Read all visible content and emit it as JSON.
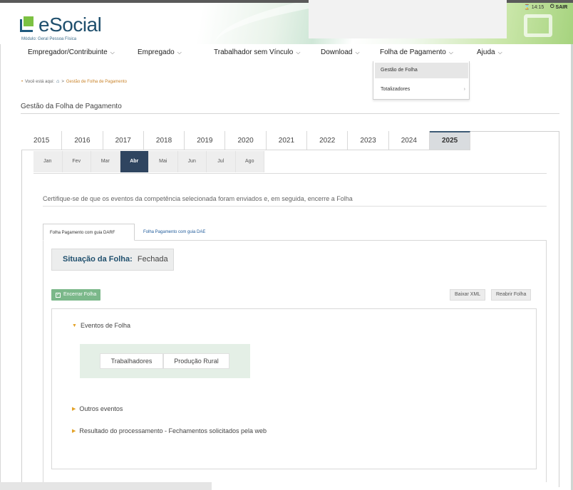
{
  "header": {
    "logo_text": "eSocial",
    "logo_sub": "Módulo: Geral Pessoa Física",
    "clock": "14:15",
    "sair": "SAIR"
  },
  "nav": {
    "items": [
      {
        "label": "Empregador/Contribuinte"
      },
      {
        "label": "Empregado"
      },
      {
        "label": "Trabalhador sem Vínculo"
      },
      {
        "label": "Download"
      },
      {
        "label": "Folha de Pagamento"
      },
      {
        "label": "Ajuda"
      }
    ],
    "dropdown": [
      {
        "label": "Gestão de Folha"
      },
      {
        "label": "Totalizadores"
      }
    ]
  },
  "breadcrumb": {
    "prefix": "Você está aqui:",
    "current": "Gestão de Folha de Pagamento"
  },
  "page": {
    "title": "Gestão da Folha de Pagamento"
  },
  "years": [
    "2015",
    "2016",
    "2017",
    "2018",
    "2019",
    "2020",
    "2021",
    "2022",
    "2023",
    "2024",
    "2025"
  ],
  "selected_year": "2025",
  "months": [
    "Jan",
    "Fev",
    "Mar",
    "Abr",
    "Mai",
    "Jun",
    "Jul",
    "Ago"
  ],
  "selected_month": "Abr",
  "notice": "Certifique-se de que os eventos da competência selecionada foram enviados e, em seguida, encerre a Folha",
  "content_tabs": {
    "active": "Folha Pagamento com guia DARF",
    "inactive": "Folha Pagamento com guia DAE"
  },
  "status": {
    "label": "Situação da Folha:",
    "value": "Fechada"
  },
  "buttons": {
    "encerrar": "Encerrar Folha",
    "baixar": "Baixar XML",
    "reabrir": "Reabrir Folha"
  },
  "sections": {
    "eventos": "Eventos de Folha",
    "trabalhadores": "Trabalhadores",
    "producao": "Produção Rural",
    "outros": "Outros eventos",
    "resultado": "Resultado do processamento - Fechamentos solicitados pela web"
  },
  "colors": {
    "accent_navy": "#2f4560",
    "logo_blue": "#1f4f6d",
    "logo_green": "#7cc142",
    "button_green": "#7bb88a",
    "triangle_orange": "#e3a32a"
  }
}
